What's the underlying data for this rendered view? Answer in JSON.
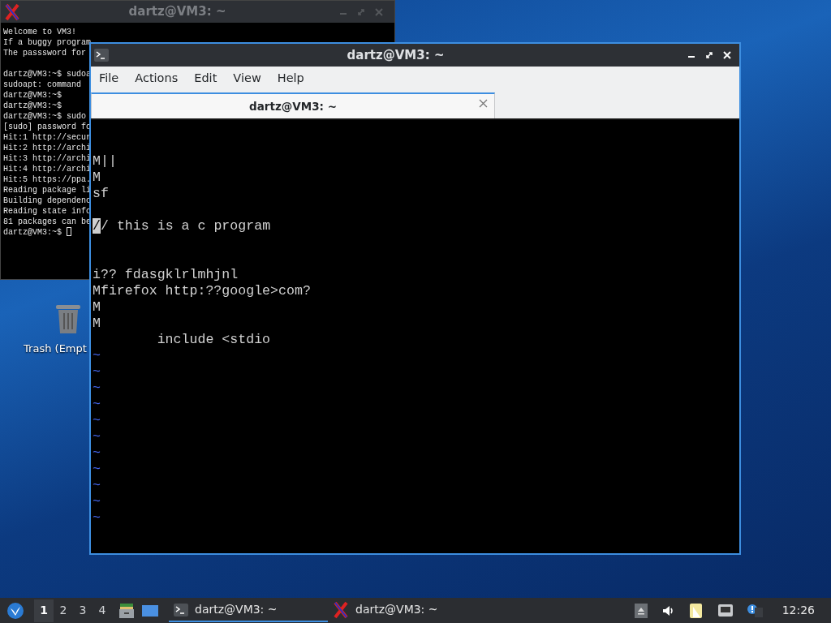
{
  "desktop": {
    "icons": [
      {
        "label": "Trash (Empt"
      }
    ]
  },
  "back_window": {
    "title": "dartz@VM3: ~",
    "active": false,
    "paragraphs": [
      {
        "lines": [
          {
            "text": "Welcome to VM3!"
          },
          {
            "text": "If a buggy program"
          },
          {
            "text": "The passsword for"
          }
        ]
      },
      {
        "lines": [
          {
            "text": "dartz@VM3:~$ sudoa"
          },
          {
            "text": "sudoapt: command"
          },
          {
            "text": "dartz@VM3:~$"
          },
          {
            "text": "dartz@VM3:~$"
          },
          {
            "text": "dartz@VM3:~$ sudo"
          },
          {
            "text": "[sudo] password fo"
          },
          {
            "text": "Hit:1 http://secur"
          },
          {
            "text": "Hit:2 http://archi"
          },
          {
            "text": "Hit:3 http://archi"
          },
          {
            "text": "Hit:4 http://archi"
          },
          {
            "text": "Hit:5 https://ppa."
          },
          {
            "text": "Reading package li"
          },
          {
            "text": "Building dependenc"
          },
          {
            "text": "Reading state info"
          },
          {
            "text": "81 packages can be"
          },
          {
            "text": "dartz@VM3:~$",
            "cursor": true
          }
        ]
      }
    ]
  },
  "front_window": {
    "title": "dartz@VM3: ~",
    "active": true,
    "menu": [
      "File",
      "Actions",
      "Edit",
      "View",
      "Help"
    ],
    "tabs": [
      {
        "label": "dartz@VM3: ~",
        "selected": true
      }
    ],
    "lines": [
      {
        "kind": "text"
      },
      {
        "kind": "text"
      },
      {
        "kind": "text",
        "text": "M||"
      },
      {
        "kind": "text",
        "text": "M"
      },
      {
        "kind": "text",
        "text": "sf"
      },
      {
        "kind": "text"
      },
      {
        "kind": "text",
        "text": "// this is a c program",
        "cursor": true
      },
      {
        "kind": "text"
      },
      {
        "kind": "text"
      },
      {
        "kind": "text",
        "text": "i?? fdasgklrlmhjnl"
      },
      {
        "kind": "text",
        "text": "Mfirefox http:??google>com?"
      },
      {
        "kind": "text",
        "text": "M"
      },
      {
        "kind": "text",
        "text": "M"
      },
      {
        "kind": "text",
        "text": "        include <stdio"
      },
      {
        "kind": "tilde",
        "text": "~"
      },
      {
        "kind": "tilde",
        "text": "~"
      },
      {
        "kind": "tilde",
        "text": "~"
      },
      {
        "kind": "tilde",
        "text": "~"
      },
      {
        "kind": "tilde",
        "text": "~"
      },
      {
        "kind": "tilde",
        "text": "~"
      },
      {
        "kind": "tilde",
        "text": "~"
      },
      {
        "kind": "tilde",
        "text": "~"
      },
      {
        "kind": "tilde",
        "text": "~"
      },
      {
        "kind": "tilde",
        "text": "~"
      },
      {
        "kind": "tilde",
        "text": "~"
      }
    ]
  },
  "taskbar": {
    "workspaces": [
      {
        "label": "1",
        "selected": true
      },
      {
        "label": "2",
        "selected": false
      },
      {
        "label": "3",
        "selected": false
      },
      {
        "label": "4",
        "selected": false
      }
    ],
    "tasks": [
      {
        "kind": "terminal",
        "label": "dartz@VM3: ~",
        "selected": true
      },
      {
        "kind": "xterm",
        "label": "dartz@VM3: ~",
        "selected": false
      }
    ],
    "clock": "12:26"
  }
}
